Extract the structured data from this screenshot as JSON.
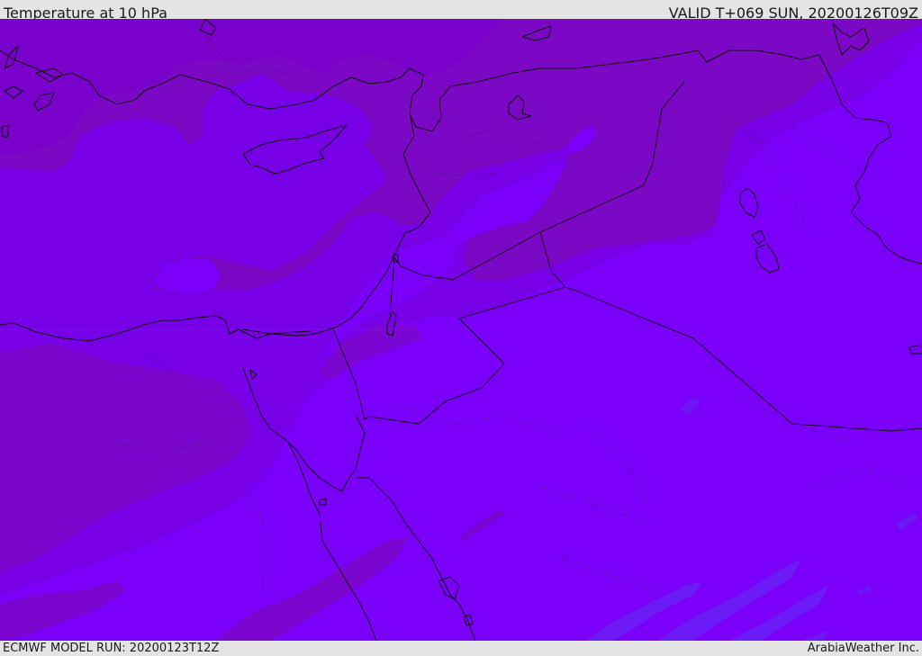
{
  "header": {
    "title": "Temperature at 10 hPa",
    "valid_time": "VALID T+069 SUN, 20200126T09Z"
  },
  "footer": {
    "model_run": "ECMWF MODEL RUN: 20200123T12Z",
    "credit": "ArabiaWeather Inc."
  },
  "map": {
    "field": "temperature",
    "level": "10 hPa",
    "colors": {
      "band_dark": "#7a00cc",
      "band_deep": "#7b08c4",
      "band_mid": "#7800e6",
      "band_bright": "#7a00fa",
      "band_cool": "#6a1ef5",
      "coastline": "#101010"
    }
  }
}
